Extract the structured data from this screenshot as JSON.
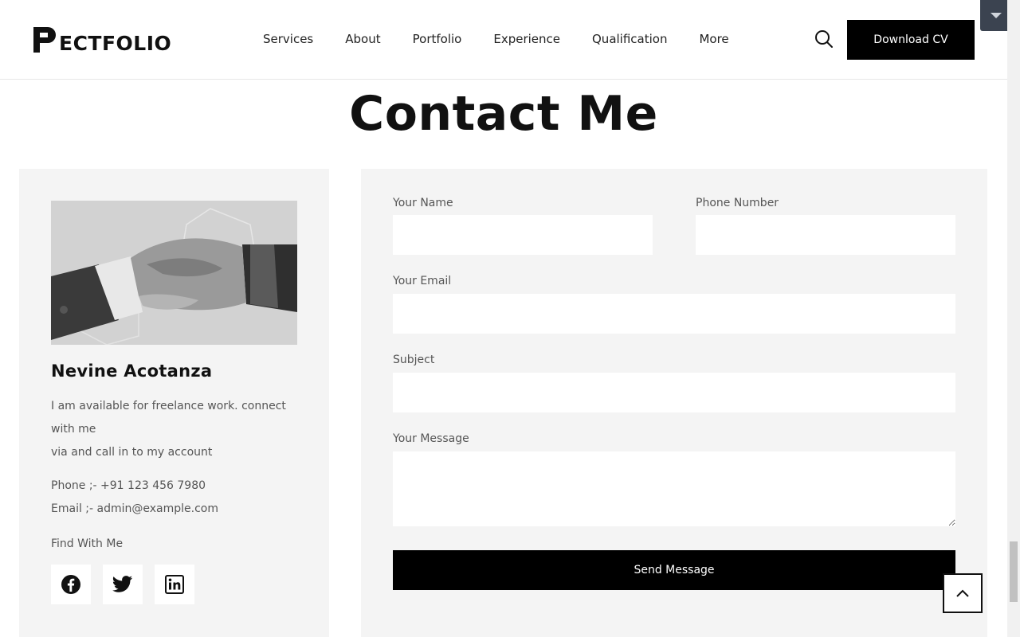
{
  "header": {
    "logo_text": "ECTFOLIO",
    "nav": [
      "Services",
      "About",
      "Portfolio",
      "Experience",
      "Qualification",
      "More"
    ],
    "download_label": "Download CV",
    "search_icon": "search-icon"
  },
  "page_title": "Contact Me",
  "profile": {
    "name": "Nevine Acotanza",
    "description_1": "I am available for freelance work. connect with me",
    "description_2": "via and call in to my account",
    "phone": "Phone ;- +91 123 456 7980",
    "email": "Email ;- admin@example.com",
    "find_label": "Find With Me",
    "socials": [
      "facebook-icon",
      "twitter-icon",
      "linkedin-icon"
    ]
  },
  "form": {
    "name_label": "Your Name",
    "phone_label": "Phone Number",
    "email_label": "Your Email",
    "subject_label": "Subject",
    "message_label": "Your Message",
    "name_value": "",
    "phone_value": "",
    "email_value": "",
    "subject_value": "",
    "message_value": "",
    "send_label": "Send Message"
  },
  "colors": {
    "accent": "#000000",
    "card_bg": "#f4f4f4",
    "text_muted": "#555555"
  }
}
